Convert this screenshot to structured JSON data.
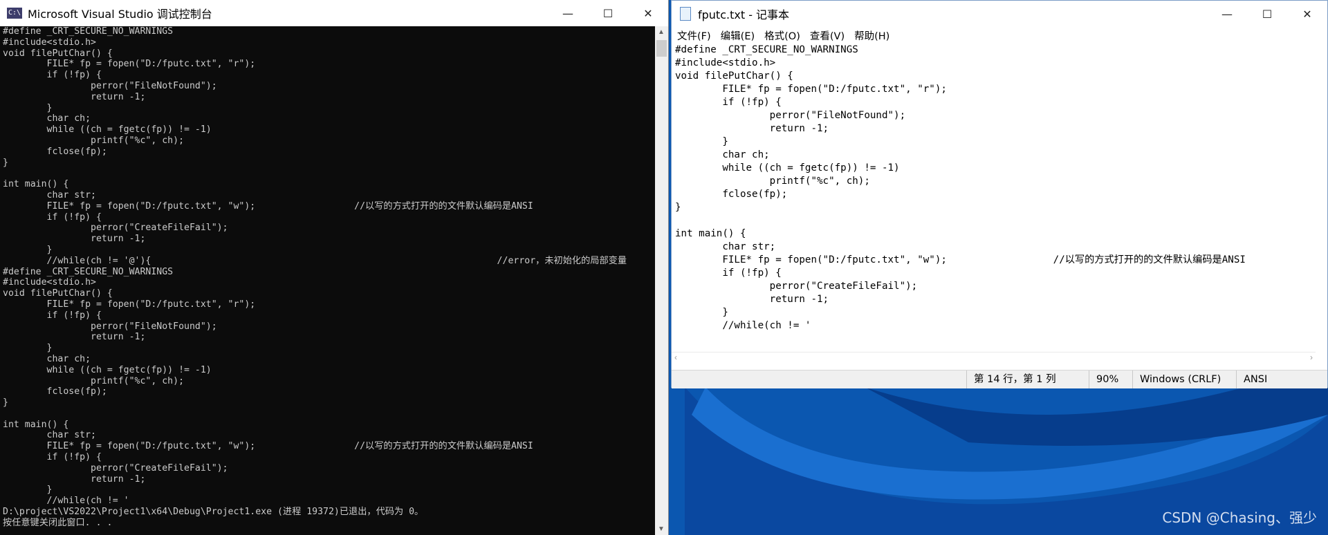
{
  "console": {
    "title": "Microsoft Visual Studio 调试控制台",
    "icon_text": "C:\\",
    "controls": {
      "minimize": "—",
      "maximize": "☐",
      "close": "✕"
    },
    "output": "#define _CRT_SECURE_NO_WARNINGS\n#include<stdio.h>\nvoid filePutChar() {\n        FILE* fp = fopen(\"D:/fputc.txt\", \"r\");\n        if (!fp) {\n                perror(\"FileNotFound\");\n                return -1;\n        }\n        char ch;\n        while ((ch = fgetc(fp)) != -1)\n                printf(\"%c\", ch);\n        fclose(fp);\n}\n\nint main() {\n        char str;\n        FILE* fp = fopen(\"D:/fputc.txt\", \"w\");                  //以写的方式打开的的文件默认编码是ANSI\n        if (!fp) {\n                perror(\"CreateFileFail\");\n                return -1;\n        }\n        //while(ch != '@'){                                                               //error，未初始化的局部变量\n#define _CRT_SECURE_NO_WARNINGS\n#include<stdio.h>\nvoid filePutChar() {\n        FILE* fp = fopen(\"D:/fputc.txt\", \"r\");\n        if (!fp) {\n                perror(\"FileNotFound\");\n                return -1;\n        }\n        char ch;\n        while ((ch = fgetc(fp)) != -1)\n                printf(\"%c\", ch);\n        fclose(fp);\n}\n\nint main() {\n        char str;\n        FILE* fp = fopen(\"D:/fputc.txt\", \"w\");                  //以写的方式打开的的文件默认编码是ANSI\n        if (!fp) {\n                perror(\"CreateFileFail\");\n                return -1;\n        }\n        //while(ch != '\nD:\\project\\VS2022\\Project1\\x64\\Debug\\Project1.exe (进程 19372)已退出，代码为 0。\n按任意键关闭此窗口. . ."
  },
  "notepad": {
    "title": "fputc.txt - 记事本",
    "controls": {
      "minimize": "—",
      "maximize": "☐",
      "close": "✕"
    },
    "menu": {
      "file": "文件(F)",
      "edit": "编辑(E)",
      "format": "格式(O)",
      "view": "查看(V)",
      "help": "帮助(H)"
    },
    "content": "#define _CRT_SECURE_NO_WARNINGS\n#include<stdio.h>\nvoid filePutChar() {\n        FILE* fp = fopen(\"D:/fputc.txt\", \"r\");\n        if (!fp) {\n                perror(\"FileNotFound\");\n                return -1;\n        }\n        char ch;\n        while ((ch = fgetc(fp)) != -1)\n                printf(\"%c\", ch);\n        fclose(fp);\n}\n\nint main() {\n        char str;\n        FILE* fp = fopen(\"D:/fputc.txt\", \"w\");                  //以写的方式打开的的文件默认编码是ANSI\n        if (!fp) {\n                perror(\"CreateFileFail\");\n                return -1;\n        }\n        //while(ch != '",
    "status": {
      "position": "第 14 行，第 1 列",
      "zoom": "90%",
      "line_ending": "Windows (CRLF)",
      "encoding": "ANSI"
    }
  },
  "watermark": "CSDN @Chasing、强少",
  "colors": {
    "console_bg": "#0c0c0c",
    "console_text": "#cccccc",
    "desktop": "#0b57b0"
  }
}
